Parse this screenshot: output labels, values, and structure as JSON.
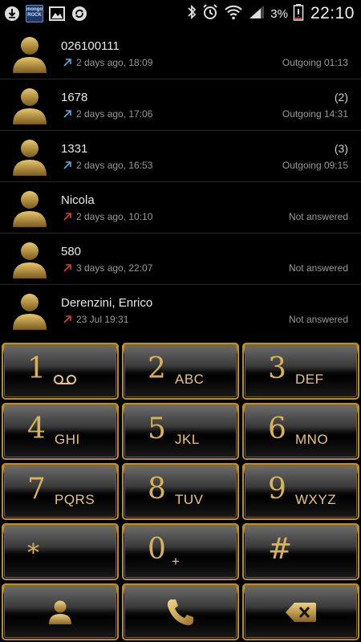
{
  "status_bar": {
    "left_icons": [
      "download-icon",
      "mongorock-app-icon",
      "gallery-icon",
      "sync-icon"
    ],
    "mongo_label": "mongo ROCK",
    "right_icons": [
      "bluetooth-icon",
      "alarm-icon",
      "wifi-icon",
      "signal-icon",
      "battery-icon"
    ],
    "battery_percent": "3%",
    "time": "22:10"
  },
  "call_log": [
    {
      "name": "026100111",
      "time": "2 days ago, 18:09",
      "count": "",
      "status": "Outgoing 01:13",
      "direction": "outgoing"
    },
    {
      "name": "1678",
      "time": "2 days ago, 17:06",
      "count": "(2)",
      "status": "Outgoing 14:31",
      "direction": "outgoing"
    },
    {
      "name": "1331",
      "time": "2 days ago, 16:53",
      "count": "(3)",
      "status": "Outgoing 09:15",
      "direction": "outgoing"
    },
    {
      "name": "Nicola",
      "time": "2 days ago, 10:10",
      "count": "",
      "status": "Not answered",
      "direction": "missed"
    },
    {
      "name": "580",
      "time": "3 days ago, 22:07",
      "count": "",
      "status": "Not answered",
      "direction": "missed"
    },
    {
      "name": "Derenzini, Enrico",
      "time": "23 Jul 19:31",
      "count": "",
      "status": "Not answered",
      "direction": "missed"
    }
  ],
  "dialpad": {
    "keys": [
      {
        "digit": "1",
        "letters": ""
      },
      {
        "digit": "2",
        "letters": "ABC"
      },
      {
        "digit": "3",
        "letters": "DEF"
      },
      {
        "digit": "4",
        "letters": "GHI"
      },
      {
        "digit": "5",
        "letters": "JKL"
      },
      {
        "digit": "6",
        "letters": "MNO"
      },
      {
        "digit": "7",
        "letters": "PQRS"
      },
      {
        "digit": "8",
        "letters": "TUV"
      },
      {
        "digit": "9",
        "letters": "WXYZ"
      },
      {
        "digit": "*",
        "letters": ""
      },
      {
        "digit": "0",
        "letters": "+"
      },
      {
        "digit": "#",
        "letters": ""
      }
    ],
    "bottom_icons": [
      "contacts-icon",
      "call-icon",
      "backspace-icon"
    ]
  },
  "colors": {
    "gold": "#d8b25a",
    "outgoing_arrow": "#5aa9d6",
    "missed_arrow": "#d0442e",
    "text_secondary": "#9a9a9a"
  }
}
